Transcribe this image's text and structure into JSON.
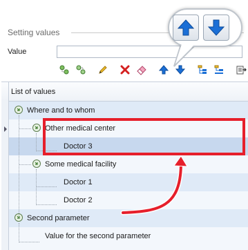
{
  "group": {
    "title": "Setting values"
  },
  "value_field": {
    "label": "Value",
    "value": ""
  },
  "toolbar": {
    "buttons": [
      {
        "name": "add-root-icon",
        "color": "#4a8a3b"
      },
      {
        "name": "add-child-icon",
        "color": "#4a8a3b"
      },
      {
        "name": "pencil-icon",
        "color": "#e0a21f"
      },
      {
        "name": "delete-icon",
        "color": "#d42020"
      },
      {
        "name": "eraser-icon",
        "color": "#e06a8a"
      },
      {
        "name": "arrow-up-icon",
        "color": "#1b6fd6"
      },
      {
        "name": "arrow-down-icon",
        "color": "#1b6fd6"
      },
      {
        "name": "expand-all-icon",
        "color": "#1b6fd6"
      },
      {
        "name": "collapse-all-icon",
        "color": "#1b6fd6"
      },
      {
        "name": "export-icon",
        "color": "#555555"
      }
    ]
  },
  "list": {
    "header": "List of values",
    "rows": [
      {
        "label": "Where and to whom"
      },
      {
        "label": "Other medical center"
      },
      {
        "label": "Doctor 3"
      },
      {
        "label": "Some medical facility"
      },
      {
        "label": "Doctor 1"
      },
      {
        "label": "Doctor 2"
      },
      {
        "label": "Second parameter"
      },
      {
        "label": "Value for the second parameter"
      }
    ]
  },
  "callout": {
    "buttons": [
      {
        "name": "arrow-up-icon",
        "color": "#1b6fd6"
      },
      {
        "name": "arrow-down-icon",
        "color": "#1b6fd6"
      }
    ]
  },
  "colors": {
    "highlight": "#e61f2b",
    "row_even": "#dfeaf7",
    "row_odd": "#f3f7fc",
    "row_selected": "#c7d8ee"
  }
}
